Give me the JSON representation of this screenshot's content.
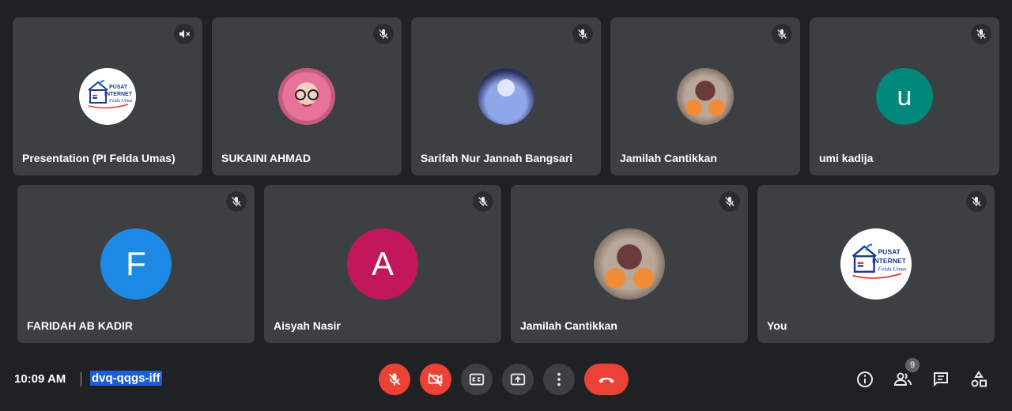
{
  "participants": [
    {
      "name": "Presentation (PI Felda Umas)",
      "avatar": "logo",
      "muted": true
    },
    {
      "name": "SUKAINI AHMAD",
      "avatar": "photo-girl",
      "muted": true
    },
    {
      "name": "Sarifah Nur Jannah Bangsari",
      "avatar": "photo-elsa",
      "muted": true
    },
    {
      "name": "Jamilah Cantikkan",
      "avatar": "photo-group",
      "muted": true
    },
    {
      "name": "umi kadija",
      "avatar_letter": "u",
      "avatar_color": "#00897b",
      "muted": true
    },
    {
      "name": "FARIDAH AB KADIR",
      "avatar_letter": "F",
      "avatar_color": "#1e88e5",
      "muted": true
    },
    {
      "name": "Aisyah Nasir",
      "avatar_letter": "A",
      "avatar_color": "#c2185b",
      "muted": true
    },
    {
      "name": "Jamilah Cantikkan",
      "avatar": "photo-group",
      "muted": true
    },
    {
      "name": "You",
      "avatar": "logo",
      "muted": true
    }
  ],
  "logo": {
    "line1": "PUSAT",
    "line2": "INTERNET",
    "line3": "Felda Umas"
  },
  "bottom_bar": {
    "time": "10:09 AM",
    "meeting_code": "dvq-qqgs-iff",
    "participant_count": "9"
  },
  "colors": {
    "background": "#202124",
    "tile": "#3c4043",
    "danger": "#ea4335",
    "selection": "#1a5fd4"
  }
}
